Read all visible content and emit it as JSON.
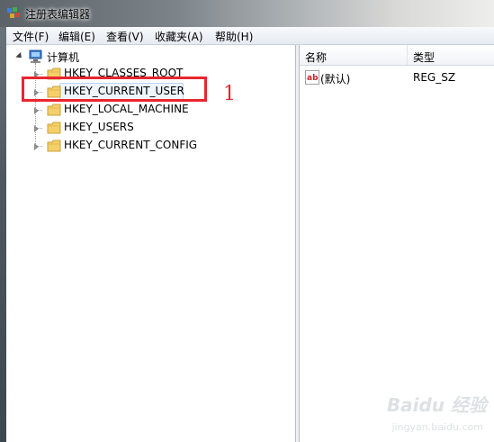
{
  "window": {
    "title": "注册表编辑器"
  },
  "menu": [
    {
      "label": "文件(F)"
    },
    {
      "label": "编辑(E)"
    },
    {
      "label": "查看(V)"
    },
    {
      "label": "收藏夹(A)"
    },
    {
      "label": "帮助(H)"
    }
  ],
  "tree": {
    "root": "计算机",
    "nodes": [
      {
        "label": "HKEY_CLASSES_ROOT"
      },
      {
        "label": "HKEY_CURRENT_USER"
      },
      {
        "label": "HKEY_LOCAL_MACHINE"
      },
      {
        "label": "HKEY_USERS"
      },
      {
        "label": "HKEY_CURRENT_CONFIG"
      }
    ],
    "selected": "HKEY_CURRENT_USER"
  },
  "list": {
    "columns": [
      "名称",
      "类型"
    ],
    "rows": [
      {
        "name": "(默认)",
        "type": "REG_SZ",
        "icon": "ab-string-icon"
      }
    ]
  },
  "annotation": {
    "number": "1",
    "color": "#e8262e"
  },
  "watermark": {
    "text": "Baidu 经验",
    "sub": "jingyan.baidu.com"
  }
}
